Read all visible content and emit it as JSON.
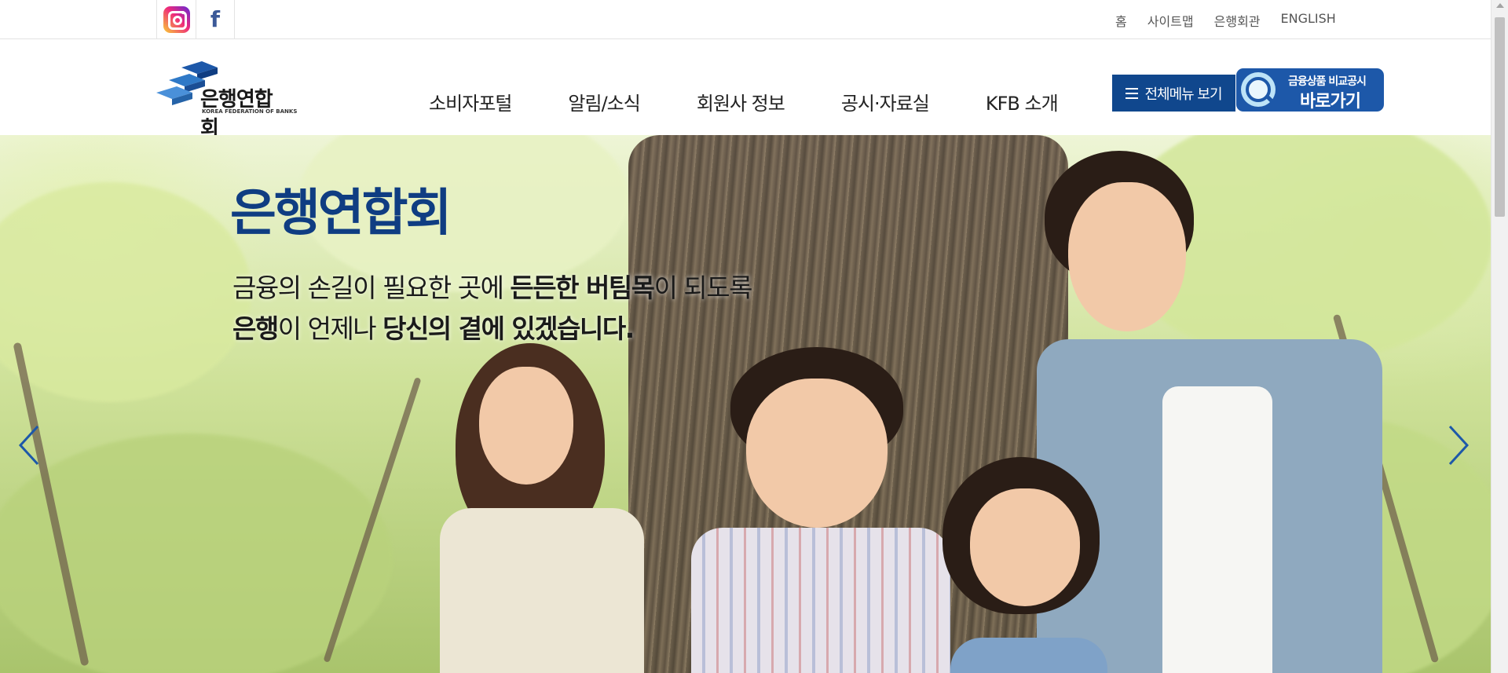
{
  "social": {
    "instagram_icon": "instagram-icon",
    "facebook_icon": "facebook-icon",
    "facebook_glyph": "f"
  },
  "utility_nav": [
    "홈",
    "사이트맵",
    "은행회관",
    "ENGLISH"
  ],
  "logo": {
    "name": "은행연합회",
    "subtitle": "KOREA FEDERATION OF BANKS",
    "colors": {
      "primary": "#1d58a9",
      "dark": "#0f3d82"
    }
  },
  "gnb": [
    "소비자포털",
    "알림/소식",
    "회원사 정보",
    "공시·자료실",
    "KFB 소개"
  ],
  "all_menu_label": "전체메뉴 보기",
  "quick_link": {
    "sub": "금융상품 비교공시",
    "main": "바로가기"
  },
  "hero": {
    "title": "은행연합회",
    "line1": {
      "a": "금융의 손길이 필요한 곳에 ",
      "b": "든든한 버팀목",
      "c": "이 되도록"
    },
    "line2": {
      "a": "은행",
      "b": "이 언제나 ",
      "c": "당신의 곁에 있겠습니다."
    },
    "title_color": "#0f3d82"
  },
  "colors": {
    "brand_navy": "#10478d",
    "brand_blue": "#1d58a9"
  }
}
